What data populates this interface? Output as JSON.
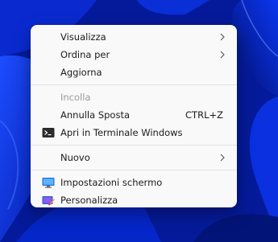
{
  "context_menu": {
    "items": [
      {
        "label": "Visualizza",
        "submenu": true
      },
      {
        "label": "Ordina per",
        "submenu": true
      },
      {
        "label": "Aggiorna"
      },
      {
        "label": "Incolla",
        "disabled": true
      },
      {
        "label": "Annulla Sposta",
        "shortcut": "CTRL+Z"
      },
      {
        "label": "Apri in Terminale Windows",
        "icon": "terminal-icon"
      },
      {
        "label": "Nuovo",
        "submenu": true
      },
      {
        "label": "Impostazioni schermo",
        "icon": "display-settings-icon"
      },
      {
        "label": "Personalizza",
        "icon": "personalize-icon"
      }
    ]
  },
  "colors": {
    "menu_background": "#f9f9f9",
    "text": "#1b1b1b",
    "disabled_text": "#9a9a9a",
    "separator": "#e3e3e3",
    "wallpaper_blue": "#0a2fd8"
  }
}
